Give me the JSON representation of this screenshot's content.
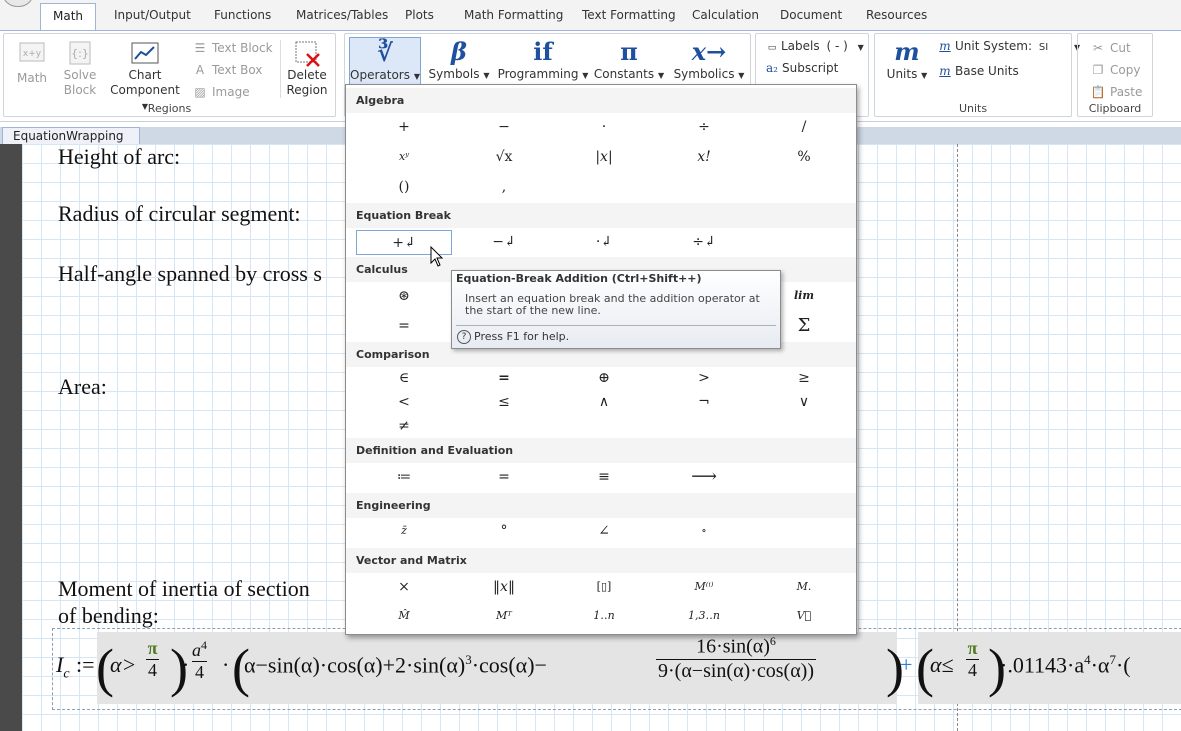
{
  "ribbon_tabs": [
    "Math",
    "Input/Output",
    "Functions",
    "Matrices/Tables",
    "Plots",
    "Math Formatting",
    "Text Formatting",
    "Calculation",
    "Document",
    "Resources"
  ],
  "active_tab": "Math",
  "regions_group": {
    "label": "Regions",
    "math": "Math",
    "solve_block": [
      "Solve",
      "Block"
    ],
    "chart_component": [
      "Chart",
      "Component"
    ],
    "text_block": "Text Block",
    "text_box": "Text Box",
    "image": "Image",
    "delete_region": [
      "Delete",
      "Region"
    ]
  },
  "math_tools": [
    {
      "label": "Operators",
      "glyph": "∛"
    },
    {
      "label": "Symbols",
      "glyph": "β"
    },
    {
      "label": "Programming",
      "glyph": "if"
    },
    {
      "label": "Constants",
      "glyph": "π"
    },
    {
      "label": "Symbolics",
      "glyph": "x→"
    }
  ],
  "style_group": {
    "labels": "Labels",
    "labels_value": "( - )",
    "subscript": "Subscript"
  },
  "units_group": {
    "label": "Units",
    "units": "Units",
    "unit_system": "Unit System:",
    "unit_system_value": "SI",
    "base_units": "Base Units"
  },
  "clipboard_group": {
    "label": "Clipboard",
    "cut": "Cut",
    "copy": "Copy",
    "paste": "Paste"
  },
  "doc_tab": {
    "name": "EquationWrapping",
    "modified": "*",
    "close": "✕"
  },
  "worksheet": {
    "labels": [
      "Height of arc:",
      "Radius of circular segment:",
      "Half-angle spanned by cross s",
      "Area:",
      "Moment of inertia of section",
      "of bending:"
    ],
    "equation": {
      "lhs": "I",
      "lhs_sub": "c",
      "assign": ":=",
      "part1": "α>",
      "pi": "π",
      "four": "4",
      "a": "a",
      "exp4": "4",
      "inner": "α−sin(α)·cos(α)+2·sin(α)",
      "exp3": "3",
      "tail": "·cos(α)−",
      "num": "16·sin(α)",
      "exp6": "6",
      "den": "9·(α−sin(α)·cos(α))",
      "plus": "+",
      "part2": "α≤",
      "coef": "·.01143·a",
      "alpha": "·α",
      "exp7": "7"
    }
  },
  "operators_popup": {
    "sections": [
      {
        "title": "Algebra",
        "ops": [
          "+",
          "−",
          "·",
          "÷",
          "/",
          "xʸ",
          "√x",
          "|x|",
          "x!",
          "%",
          "()",
          ","
        ]
      },
      {
        "title": "Equation Break",
        "ops": [
          "+↲",
          "−↲",
          "·↲",
          "÷↲"
        ]
      },
      {
        "title": "Calculus",
        "ops": [
          "⊛",
          "lim",
          "=",
          "Σ"
        ]
      },
      {
        "title": "Comparison",
        "ops": [
          "∈",
          "=",
          "⊕",
          ">",
          "≥",
          "<",
          "≤",
          "∧",
          "¬",
          "∨",
          "≠"
        ]
      },
      {
        "title": "Definition and Evaluation",
        "ops": [
          "≔",
          "=",
          "≡",
          "⟶"
        ]
      },
      {
        "title": "Engineering",
        "ops": [
          "z̄",
          "°",
          "∠",
          "∘"
        ]
      },
      {
        "title": "Vector and Matrix",
        "ops": [
          "×",
          "‖x‖",
          "[▯]",
          "M⁽ⁱ⁾",
          "M.",
          "M̂",
          "Mᵀ",
          "1‥n",
          "1,3‥n",
          "V⃗"
        ]
      }
    ]
  },
  "tooltip": {
    "title": "Equation-Break Addition (Ctrl+Shift++)",
    "body": "Insert an equation break and the addition operator at the start of the new line.",
    "help": "Press F1 for help.",
    "help_icon": "?"
  }
}
